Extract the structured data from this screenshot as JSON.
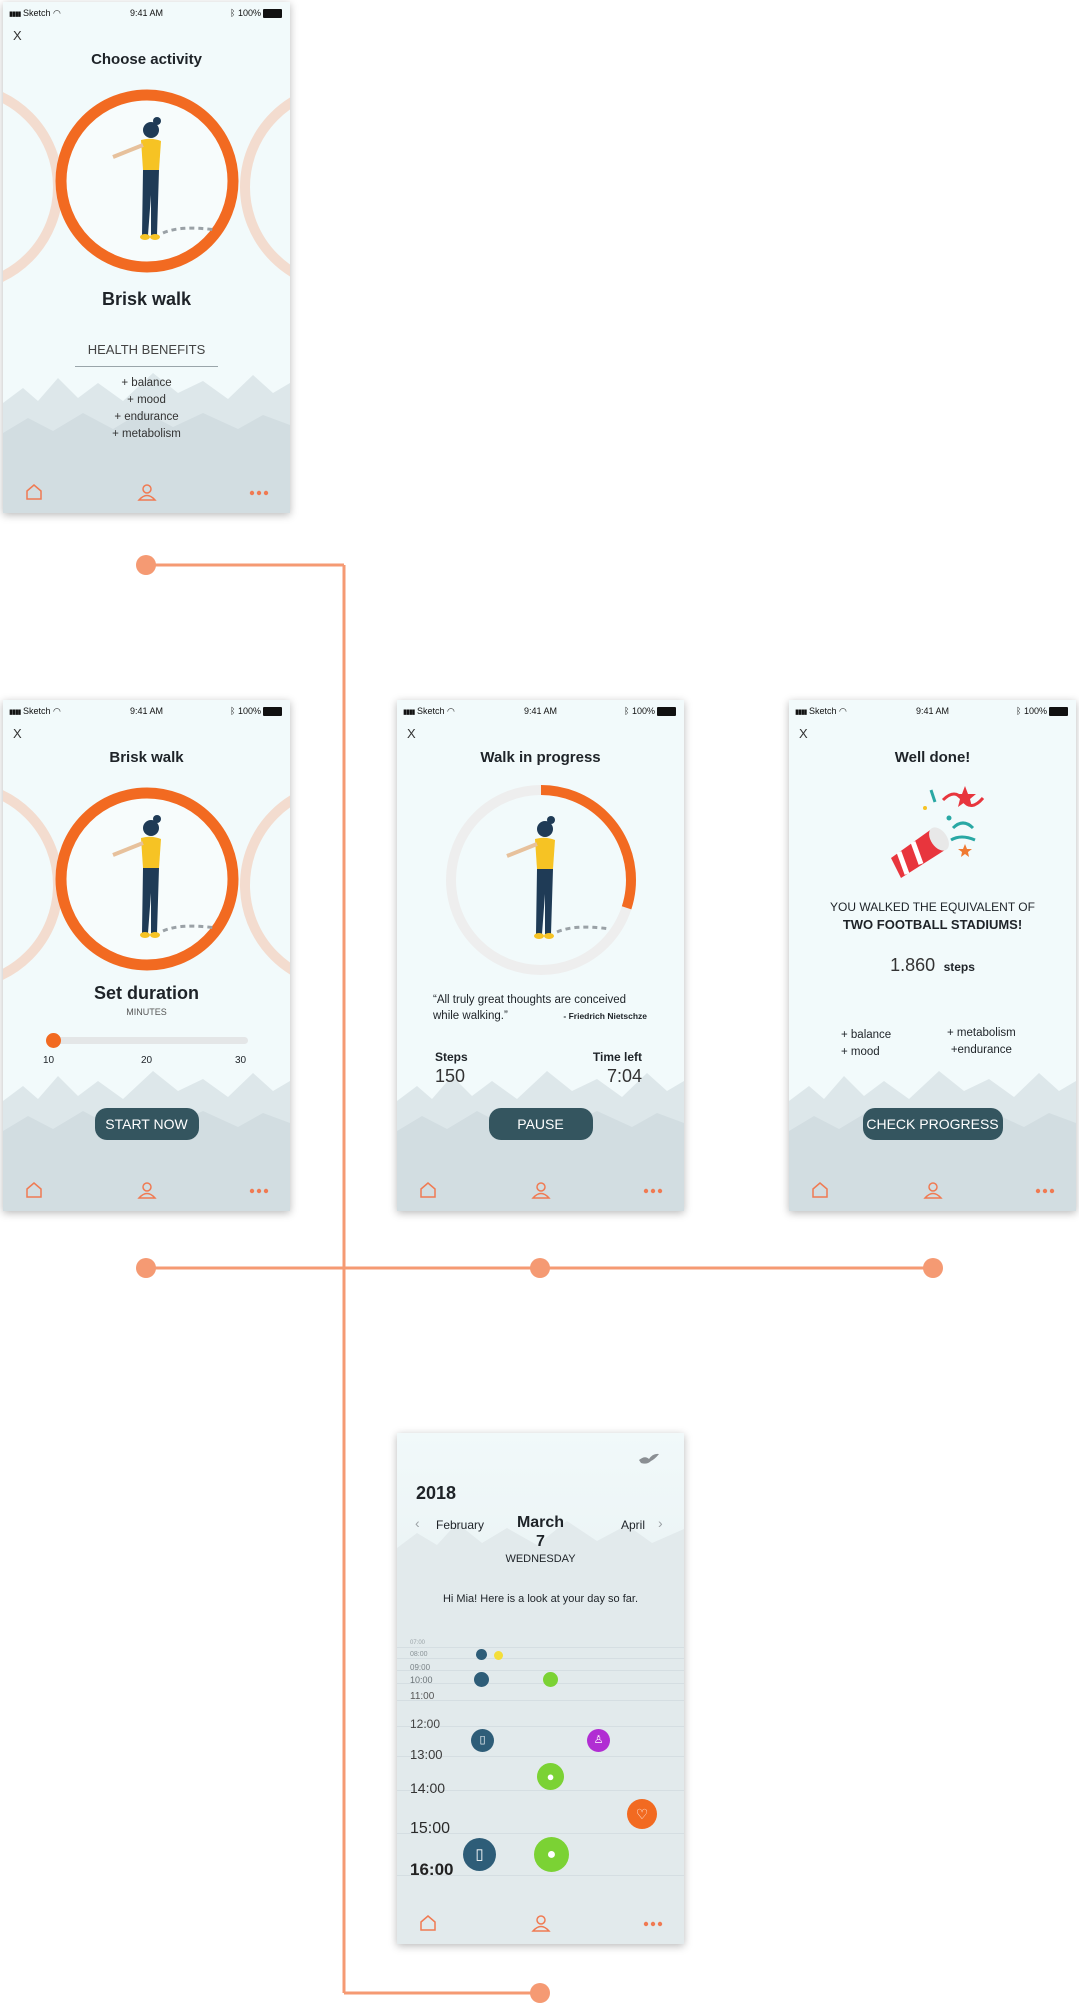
{
  "status_bar": {
    "carrier": "Sketch",
    "time": "9:41 AM",
    "battery": "100%"
  },
  "close_label": "X",
  "screen_choose": {
    "title": "Choose activity",
    "activity_name": "Brisk walk",
    "benefits_heading": "HEALTH BENEFITS",
    "benefits": [
      "+ balance",
      "+ mood",
      "+ endurance",
      "+ metabolism"
    ]
  },
  "screen_duration": {
    "title": "Brisk walk",
    "heading": "Set duration",
    "unit": "MINUTES",
    "slider": {
      "min": 10,
      "max": 30,
      "value": 10,
      "ticks": [
        "10",
        "20",
        "30"
      ]
    },
    "start_button": "START NOW"
  },
  "screen_progress": {
    "title": "Walk in progress",
    "progress_fraction": 0.3,
    "quote": "“All truly great thoughts are conceived while walking.”",
    "quote_author": "-  Friedrich Nietschze",
    "steps_label": "Steps",
    "steps_value": "150",
    "time_left_label": "Time left",
    "time_left_value": "7:04",
    "pause_button": "PAUSE"
  },
  "screen_done": {
    "title": "Well done!",
    "line1": "YOU WALKED THE EQUIVALENT OF",
    "line2": "TWO FOOTBALL STADIUMS!",
    "steps_value": "1.860",
    "steps_unit": "steps",
    "benefits_left": [
      "+ balance",
      "+ mood"
    ],
    "benefits_right": [
      "+ metabolism",
      "+endurance"
    ],
    "check_button": "CHECK PROGRESS"
  },
  "screen_calendar": {
    "year": "2018",
    "prev_month": "February",
    "month": "March",
    "day": "7",
    "weekday": "WEDNESDAY",
    "next_month": "April",
    "greeting": "Hi Mia! Here is a look at your day so far.",
    "times_small": [
      "07:00",
      "08:00",
      "09:00",
      "10:00"
    ],
    "times": [
      "11:00",
      "12:00",
      "13:00",
      "14:00",
      "15:00",
      "16:00"
    ]
  },
  "colors": {
    "accent": "#f26a21",
    "flow_line": "#f59a73",
    "button": "#34555f",
    "ring_side": "#f3dccf",
    "shirt": "#f6c324",
    "pants": "#1f3b56"
  }
}
